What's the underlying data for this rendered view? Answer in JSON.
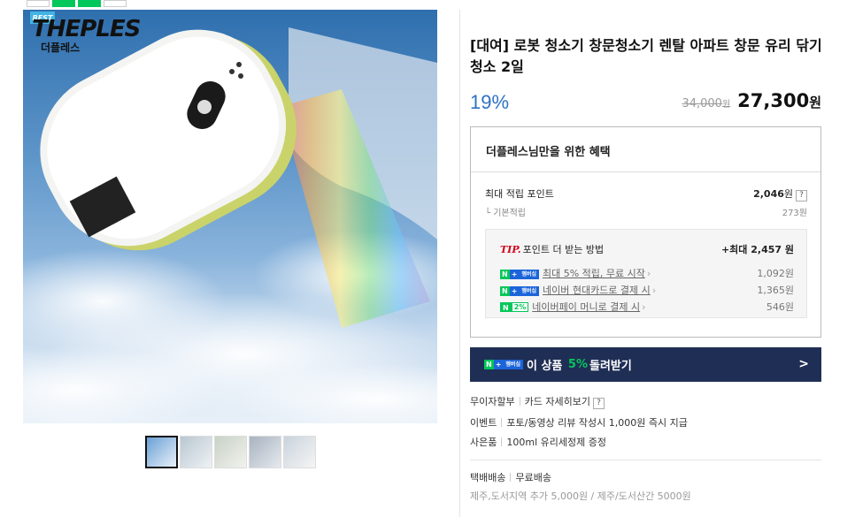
{
  "badge": "BEST",
  "logo": {
    "main": "THEPLES",
    "sub": "더플레스"
  },
  "product": {
    "title": "[대여] 로봇 청소기 창문청소기 렌탈 아파트 창문 유리 닦기 청소 2일",
    "discount": "19%",
    "original_price": "34,000",
    "original_unit": "원",
    "price": "27,300",
    "price_unit": "원"
  },
  "benefit": {
    "header": "더플레스님만을 위한 혜택",
    "max_points_label": "최대 적립 포인트",
    "max_points_value": "2,046",
    "max_points_unit": "원",
    "help": "?",
    "basic_label": "기본적립",
    "basic_value": "273원",
    "tip": {
      "tip_mark": "TIP.",
      "title": "포인트 더 받는 방법",
      "total": "+최대 2,457 원",
      "items": [
        {
          "badge": "N + 멤버십",
          "label": "최대 5% 적립, 무료 시작",
          "amount": "1,092원"
        },
        {
          "badge": "N + 멤버십",
          "label": "네이버 현대카드로 결제 시",
          "amount": "1,365원"
        },
        {
          "badge": "N 2%",
          "label": "네이버페이 머니로 결제 시",
          "amount": "546원"
        }
      ]
    }
  },
  "membership_bar": {
    "badge": "N + 멤버십",
    "text_before": "이 상품",
    "pct": "5%",
    "text_after": "돌려받기",
    "arrow": ">"
  },
  "meta": {
    "installment": {
      "label": "무이자할부",
      "value": "카드 자세히보기",
      "help": "?"
    },
    "event": {
      "label": "이벤트",
      "value": "포토/동영상 리뷰 작성시 1,000원 즉시 지급"
    },
    "gift": {
      "label": "사은품",
      "value": "100ml 유리세정제 증정"
    },
    "shipping": {
      "label": "택배배송",
      "value": "무료배송",
      "extra": "제주,도서지역 추가 5,000원 / 제주/도서산간 5000원"
    }
  },
  "thumbnails_count": 5,
  "colors": {
    "accent_blue": "#2f72c4",
    "naver_green": "#03c75a",
    "bar_navy": "#1f2e55",
    "tip_red": "#d0021b"
  }
}
